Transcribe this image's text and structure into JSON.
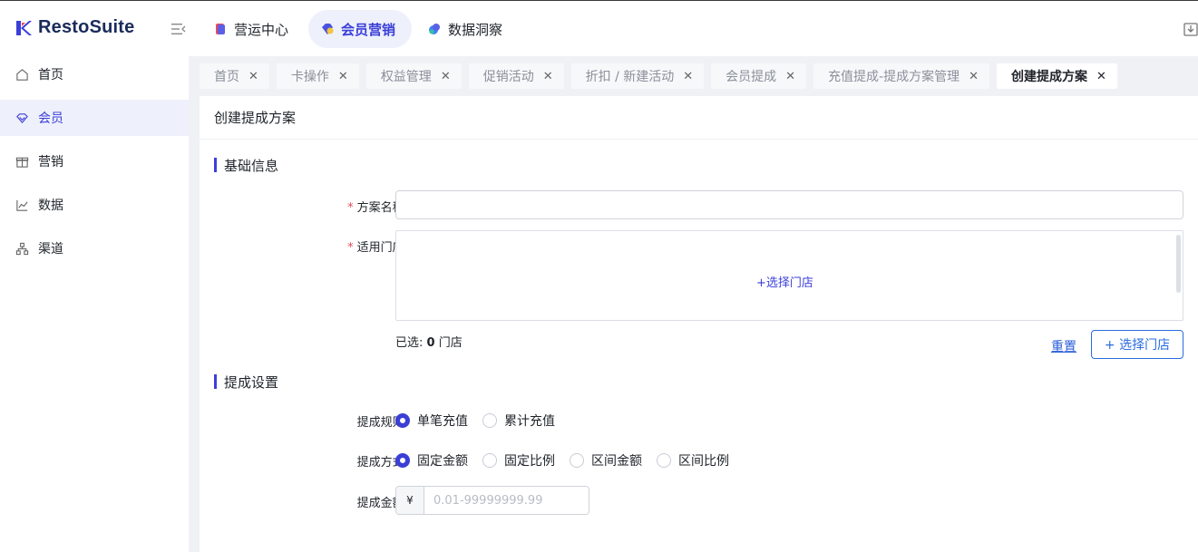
{
  "brand": {
    "name": "RestoSuite"
  },
  "topnav": [
    {
      "label": "营运中心"
    },
    {
      "label": "会员营销"
    },
    {
      "label": "数据洞察"
    }
  ],
  "sidebar": {
    "items": [
      {
        "label": "首页"
      },
      {
        "label": "会员"
      },
      {
        "label": "营销"
      },
      {
        "label": "数据"
      },
      {
        "label": "渠道"
      }
    ]
  },
  "tabs": [
    {
      "label": "首页"
    },
    {
      "label": "卡操作"
    },
    {
      "label": "权益管理"
    },
    {
      "label": "促销活动"
    },
    {
      "label": "折扣 / 新建活动"
    },
    {
      "label": "会员提成"
    },
    {
      "label": "充值提成-提成方案管理"
    },
    {
      "label": "创建提成方案"
    }
  ],
  "page": {
    "title": "创建提成方案",
    "basic_section": "基础信息",
    "name_label": "方案名称:",
    "stores_label": "适用门店:",
    "select_store_link": "+选择门店",
    "selected_prefix": "已选:",
    "selected_count": "0",
    "selected_suffix": "门店",
    "reset_label": "重置",
    "select_store_button": "+ 选择门店",
    "commission_section": "提成设置",
    "rule_label": "提成规则:",
    "rule_options": [
      "单笔充值",
      "累计充值"
    ],
    "method_label": "提成方式:",
    "method_options": [
      "固定金额",
      "固定比例",
      "区间金额",
      "区间比例"
    ],
    "amount_label": "提成金额:",
    "currency": "¥",
    "amount_placeholder": "0.01-99999999.99"
  }
}
